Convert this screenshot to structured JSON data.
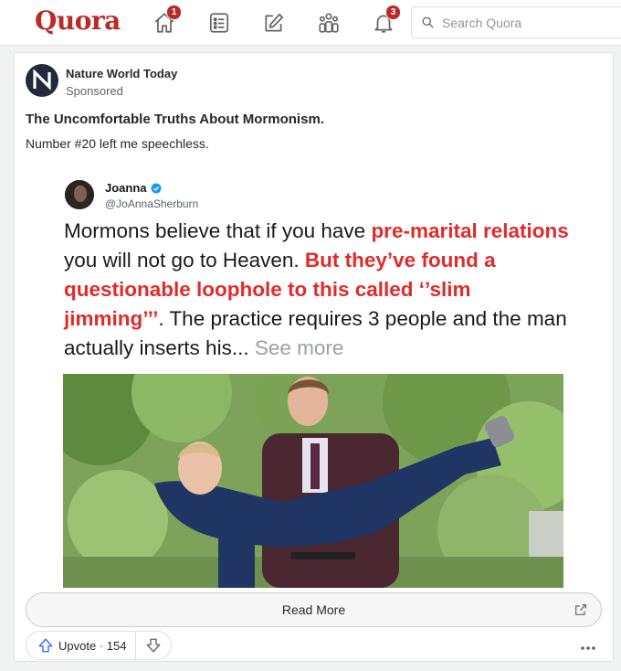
{
  "header": {
    "logo": "Quora",
    "home_badge": "1",
    "notifications_badge": "3",
    "search_placeholder": "Search Quora",
    "icons": [
      "home-icon",
      "answer-list-icon",
      "write-icon",
      "spaces-icon",
      "notifications-icon",
      "search-icon"
    ]
  },
  "post": {
    "publisher": "Nature World Today",
    "label": "Sponsored",
    "headline": "The Uncomfortable Truths About Mormonism.",
    "subline": "Number #20 left me speechless.",
    "tweet": {
      "name": "Joanna",
      "handle": "@JoAnnaSherburn",
      "text_1": "Mormons believe that if you have ",
      "text_red_1": "pre-marital relations",
      "text_2": " you will not go to Heaven. ",
      "text_red_2": "But they’ve found a questionable loophole to this called ‘’slim jimming’’’",
      "text_3": ". The practice requires 3 people and the man actually inserts his... ",
      "see_more": "See more"
    },
    "read_more": "Read More",
    "upvote_label": "Upvote",
    "upvote_separator": " · ",
    "upvote_count": "154"
  },
  "colors": {
    "brand": "#b92b27",
    "highlight_red": "#e02b2b",
    "verified_blue": "#1d9bf0",
    "upvote_blue": "#2e69ff"
  }
}
